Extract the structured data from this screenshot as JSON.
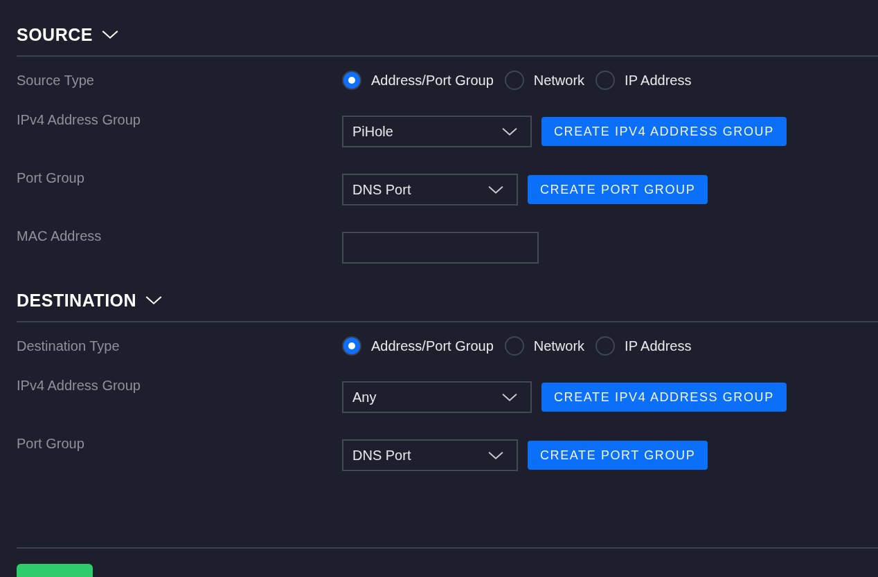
{
  "sections": [
    {
      "title": "SOURCE",
      "expanded": true,
      "rows": [
        {
          "kind": "radio",
          "label": "Source Type",
          "options": [
            {
              "label": "Address/Port Group",
              "selected": true
            },
            {
              "label": "Network",
              "selected": false
            },
            {
              "label": "IP Address",
              "selected": false
            }
          ]
        },
        {
          "kind": "select",
          "label": "IPv4 Address Group",
          "value": "PiHole",
          "button": "CREATE IPV4 ADDRESS GROUP"
        },
        {
          "kind": "select",
          "label": "Port Group",
          "value": "DNS Port",
          "button": "CREATE PORT GROUP"
        },
        {
          "kind": "input",
          "label": "MAC Address"
        }
      ]
    },
    {
      "title": "DESTINATION",
      "expanded": true,
      "rows": [
        {
          "kind": "radio",
          "label": "Destination Type",
          "options": [
            {
              "label": "Address/Port Group",
              "selected": true
            },
            {
              "label": "Network",
              "selected": false
            },
            {
              "label": "IP Address",
              "selected": false
            }
          ]
        },
        {
          "kind": "select",
          "label": "IPv4 Address Group",
          "value": "Any",
          "button": "CREATE IPV4 ADDRESS GROUP"
        },
        {
          "kind": "select",
          "label": "Port Group",
          "value": "DNS Port",
          "button": "CREATE PORT GROUP"
        }
      ]
    }
  ]
}
